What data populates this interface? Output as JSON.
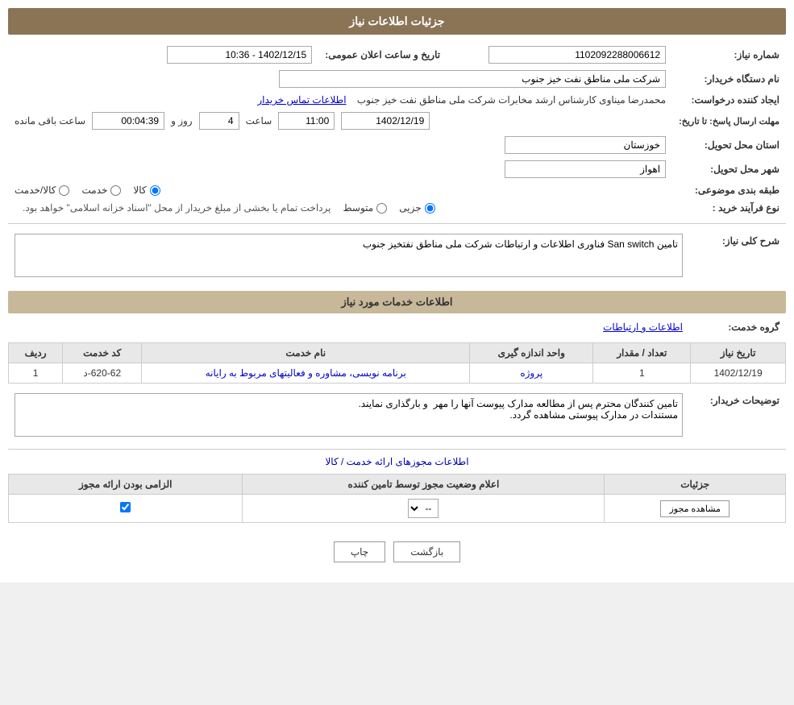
{
  "page": {
    "title": "جزئیات اطلاعات نیاز",
    "sections": {
      "basic_info": {
        "need_number_label": "شماره نیاز:",
        "need_number_value": "1102092288006612",
        "buyer_org_label": "نام دستگاه خریدار:",
        "buyer_org_value": "شرکت ملی مناطق نفت خیز جنوب",
        "creator_label": "ایجاد کننده درخواست:",
        "creator_value": "محمدرضا میناوی کارشناس ارشد مخابرات شرکت ملی مناطق نفت خیز جنوب",
        "contact_link": "اطلاعات تماس خریدار",
        "announce_date_label": "تاریخ و ساعت اعلان عمومی:",
        "announce_date_value": "1402/12/15 - 10:36",
        "response_deadline_label": "مهلت ارسال پاسخ: تا تاریخ:",
        "response_date_value": "1402/12/19",
        "response_time_value": "11:00",
        "response_days_value": "4",
        "response_remaining_value": "00:04:39",
        "province_label": "استان محل تحویل:",
        "province_value": "خوزستان",
        "city_label": "شهر محل تحویل:",
        "city_value": "اهواز",
        "category_label": "طبقه بندی موضوعی:",
        "purchase_type_label": "نوع فرآیند خرید :",
        "purchase_type_note": "پرداخت تمام یا بخشی از مبلغ خریدار از محل \"اسناد خزانه اسلامی\" خواهد بود.",
        "saatbaghimande_label": "ساعت باقی مانده",
        "rooz_label": "روز و",
        "saaat_label": "ساعت"
      },
      "need_description": {
        "title": "شرح کلی نیاز:",
        "description_value": "تامین San switch فناوری اطلاعات و ارتباطات شرکت ملی مناطق نفتخیز جنوب"
      },
      "services_info": {
        "title": "اطلاعات خدمات مورد نیاز",
        "service_group_label": "گروه خدمت:",
        "service_group_value": "اطلاعات و ارتباطات",
        "table_headers": {
          "row_number": "ردیف",
          "service_code": "کد خدمت",
          "service_name": "نام خدمت",
          "unit": "واحد اندازه گیری",
          "quantity": "تعداد / مقدار",
          "date": "تاریخ نیاز"
        },
        "table_rows": [
          {
            "row": "1",
            "code": "620-62-د",
            "name": "برنامه نویسی، مشاوره و فعالیتهای مربوط به رایانه",
            "unit": "پروژه",
            "quantity": "1",
            "date": "1402/12/19"
          }
        ]
      },
      "buyer_notes": {
        "title": "توضیحات خریدار:",
        "content": "تامین کنندگان محترم پس از مطالعه مدارک پیوست آنها را مهر  و بارگذاری نمایند.\nمستندات در مدارک پیوستی مشاهده گردد."
      },
      "permits_info": {
        "title": "اطلاعات مجوزهای ارائه خدمت / کالا",
        "table_headers": {
          "required": "الزامی بودن ارائه مجوز",
          "status_announcement": "اعلام وضعیت مجوز توسط تامین کننده",
          "details": "جزئیات"
        },
        "table_rows": [
          {
            "required_checked": true,
            "status_value": "--",
            "details_label": "مشاهده مجوز"
          }
        ]
      }
    },
    "radio_options": {
      "category": [
        "کالا",
        "خدمت",
        "کالا/خدمت"
      ],
      "purchase_type": [
        "جزیی",
        "متوسط"
      ]
    },
    "buttons": {
      "print": "چاپ",
      "back": "بازگشت"
    }
  }
}
